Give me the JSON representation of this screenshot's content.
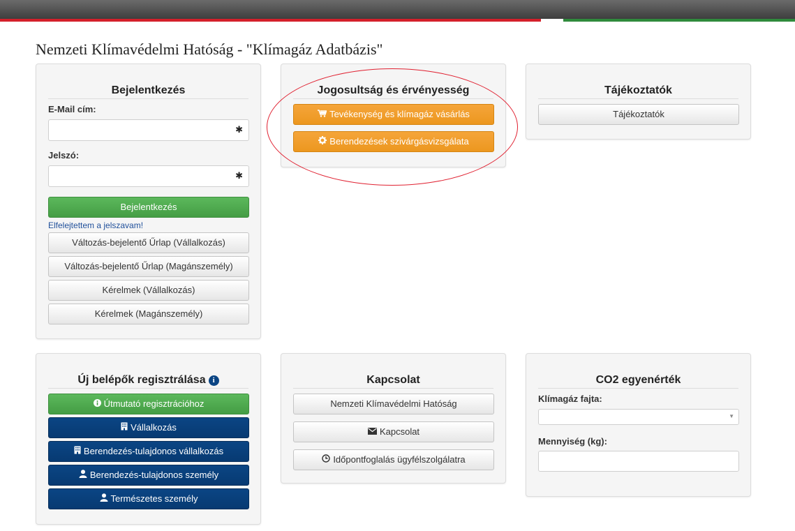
{
  "page": {
    "title": "Nemzeti Klímavédelmi Hatóság - \"Klímagáz Adatbázis\""
  },
  "login": {
    "title": "Bejelentkezés",
    "email_label": "E-Mail cím:",
    "email_value": "",
    "password_label": "Jelszó:",
    "password_value": "",
    "required_marker": "✱",
    "login_button": "Bejelentkezés",
    "forgot_link": "Elfelejtettem a jelszavam!",
    "buttons": [
      "Változás-bejelentő Űrlap (Vállalkozás)",
      "Változás-bejelentő Űrlap (Magánszemély)",
      "Kérelmek (Vállalkozás)",
      "Kérelmek (Magánszemély)"
    ]
  },
  "eligibility": {
    "title": "Jogosultság és érvényesség",
    "buttons": [
      {
        "icon": "cart-icon",
        "label": "Tevékenység és klímagáz vásárlás"
      },
      {
        "icon": "gear-icon",
        "label": "Berendezések szivárgásvizsgálata"
      }
    ]
  },
  "info": {
    "title": "Tájékoztatók",
    "button": "Tájékoztatók"
  },
  "registration": {
    "title": "Új belépők regisztrálása",
    "guide_button": "Útmutató regisztrációhoz",
    "buttons": [
      {
        "icon": "building-icon",
        "label": "Vállalkozás"
      },
      {
        "icon": "building-icon",
        "label": "Berendezés-tulajdonos vállalkozás"
      },
      {
        "icon": "user-icon",
        "label": "Berendezés-tulajdonos személy"
      },
      {
        "icon": "user-icon",
        "label": "Természetes személy"
      }
    ]
  },
  "contact": {
    "title": "Kapcsolat",
    "buttons": [
      {
        "icon": "",
        "label": "Nemzeti Klímavédelmi Hatóság"
      },
      {
        "icon": "envelope-icon",
        "label": "Kapcsolat"
      },
      {
        "icon": "clock-icon",
        "label": "Időpontfoglalás ügyfélszolgálatra"
      }
    ]
  },
  "co2": {
    "title": "CO2 egyenérték",
    "gas_type_label": "Klímagáz fajta:",
    "gas_type_value": "",
    "quantity_label": "Mennyiség (kg):",
    "quantity_value": ""
  },
  "colors": {
    "accent_green": "#5cb85c",
    "accent_orange": "#f0a030",
    "accent_navy": "#0b4584",
    "highlight_oval": "#e02030",
    "flag_red": "#d4202b",
    "flag_green": "#2f8a3c"
  }
}
